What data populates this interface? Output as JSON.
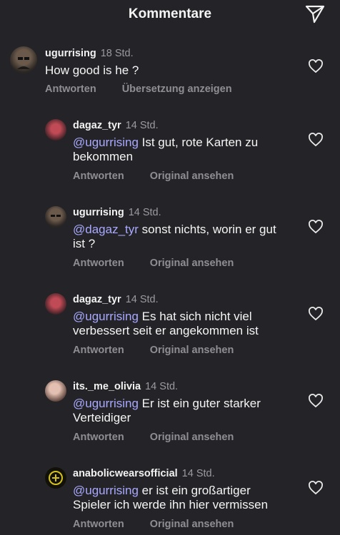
{
  "header": {
    "title": "Kommentare",
    "share_icon": "paper-plane-icon"
  },
  "comments": [
    {
      "user": "ugurrising",
      "time": "18 Std.",
      "mention": "",
      "text": "How good is he ?",
      "reply": "Antworten",
      "secondary": "Übersetzung anzeigen",
      "avatar_color": "#4a3a30"
    },
    {
      "user": "dagaz_tyr",
      "time": "14 Std.",
      "mention": "@ugurrising",
      "text": "Ist gut, rote Karten zu bekommen",
      "reply": "Antworten",
      "secondary": "Original ansehen",
      "avatar_color": "#7a2f3a"
    },
    {
      "user": "ugurrising",
      "time": "14 Std.",
      "mention": "@dagaz_tyr",
      "text": "sonst nichts, worin er gut ist ?",
      "reply": "Antworten",
      "secondary": "Original ansehen",
      "avatar_color": "#4a3a30"
    },
    {
      "user": "dagaz_tyr",
      "time": "14 Std.",
      "mention": "@ugurrising",
      "text": "Es hat sich nicht viel verbessert seit er angekommen ist",
      "reply": "Antworten",
      "secondary": "Original ansehen",
      "avatar_color": "#7a2f3a"
    },
    {
      "user": "its._me_olivia",
      "time": "14 Std.",
      "mention": "@ugurrising",
      "text": "Er ist ein guter starker Verteidiger",
      "reply": "Antworten",
      "secondary": "Original ansehen",
      "avatar_color": "#8a6a62"
    },
    {
      "user": "anabolicwearsofficial",
      "time": "14 Std.",
      "mention": "@ugurrising",
      "text": "er ist ein großartiger Spieler ich werde ihn hier vermissen",
      "reply": "Antworten",
      "secondary": "Original ansehen",
      "avatar_color": "#1c1c10"
    }
  ],
  "colors": {
    "background": "#242428",
    "mention": "#a8a9ff",
    "muted": "#8e8e93"
  }
}
